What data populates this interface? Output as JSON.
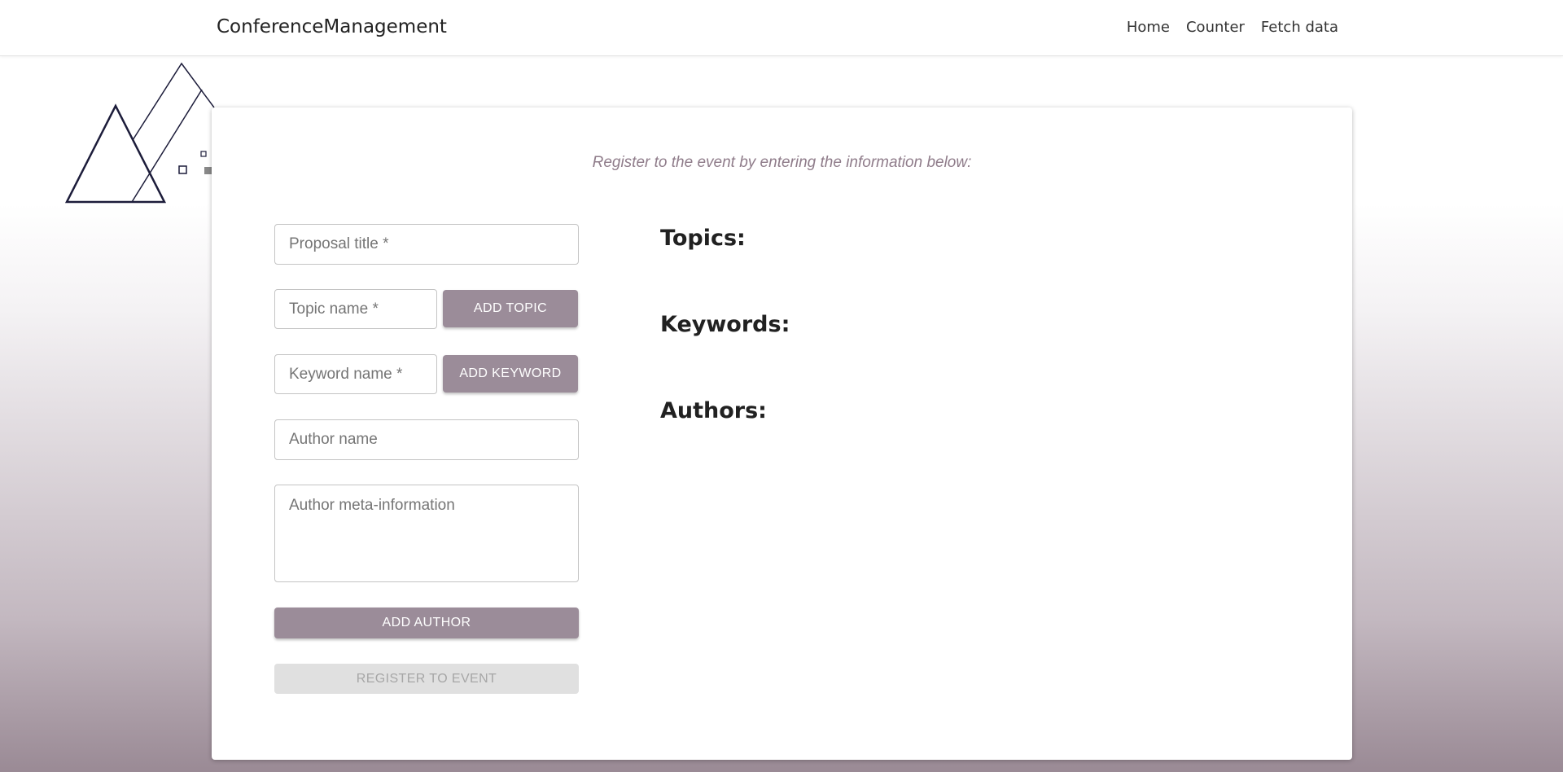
{
  "navbar": {
    "brand": "ConferenceManagement",
    "links": [
      "Home",
      "Counter",
      "Fetch data"
    ]
  },
  "form": {
    "subtitle": "Register to the event by entering the information below:",
    "proposal_title_placeholder": "Proposal title *",
    "topic_name_placeholder": "Topic name *",
    "add_topic_label": "ADD TOPIC",
    "keyword_name_placeholder": "Keyword name *",
    "add_keyword_label": "ADD KEYWORD",
    "author_name_placeholder": "Author name",
    "author_meta_placeholder": "Author meta-information",
    "add_author_label": "ADD AUTHOR",
    "register_label": "REGISTER TO EVENT"
  },
  "summary": {
    "topics_heading": "Topics:",
    "keywords_heading": "Keywords:",
    "authors_heading": "Authors:"
  },
  "colors": {
    "accent": "#9b8c99",
    "subtitle": "#8f7c8a",
    "disabled_bg": "#e0e0e0",
    "logo_stroke": "#1c1c3a"
  }
}
